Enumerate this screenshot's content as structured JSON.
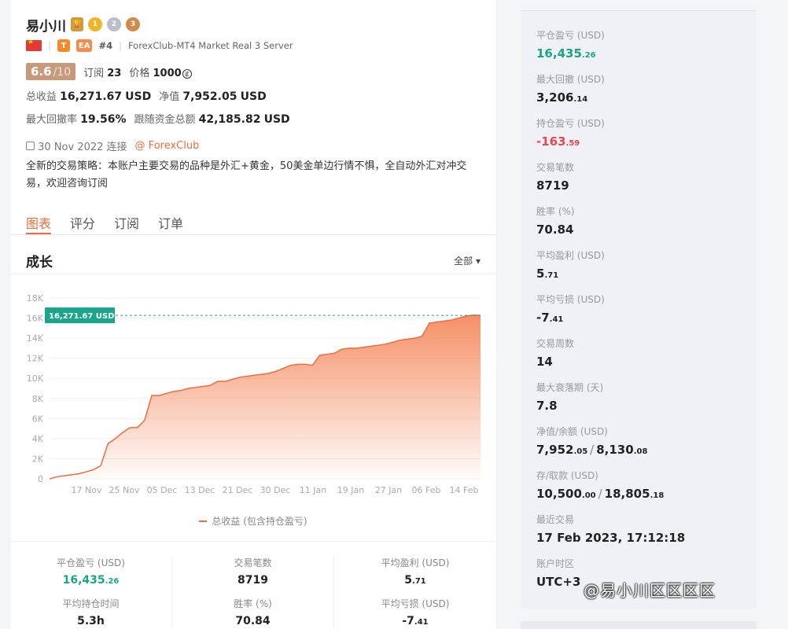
{
  "profile": {
    "name": "易小川",
    "medals": [
      "1",
      "2",
      "3"
    ],
    "tag_t": "T",
    "tag_ea": "EA",
    "rank": "#4",
    "server": "ForexClub-MT4 Market Real 3 Server",
    "score": "6.6",
    "score_den": "/10",
    "subs_label": "订阅",
    "subs_value": "23",
    "price_label": "价格",
    "price_value": "1000",
    "total_label": "总收益",
    "total_int": "16,271",
    "total_dec": ".67",
    "total_unit": "USD",
    "equity_label": "净值",
    "equity_int": "7,952",
    "equity_dec": ".05",
    "equity_unit": "USD",
    "dd_label": "最大回撤率",
    "dd_value": "19.56%",
    "follow_label": "跟随资金总额",
    "follow_int": "42,185",
    "follow_dec": ".82",
    "follow_unit": "USD",
    "connected": "30 Nov 2022 连接",
    "broker": "@ ForexClub",
    "description": "全新的交易策略：本账户主要交易的品种是外汇+黄金，50美金单边行情不惧，全自动外汇对冲交易，欢迎咨询订阅"
  },
  "tabs": [
    "图表",
    "评分",
    "订阅",
    "订单"
  ],
  "chart_section": {
    "title": "成长",
    "range": "全部 ▾"
  },
  "chart_data": {
    "type": "area",
    "x": [
      "10 Nov",
      "11 Nov",
      "12 Nov",
      "13 Nov",
      "14 Nov",
      "15 Nov",
      "16 Nov",
      "17 Nov",
      "18 Nov",
      "19 Nov",
      "20 Nov",
      "21 Nov",
      "22 Nov",
      "23 Nov",
      "24 Nov",
      "25 Nov",
      "27 Nov",
      "29 Nov",
      "1 Dec",
      "3 Dec",
      "5 Dec",
      "7 Dec",
      "9 Dec",
      "11 Dec",
      "13 Dec",
      "15 Dec",
      "17 Dec",
      "19 Dec",
      "21 Dec",
      "23 Dec",
      "25 Dec",
      "27 Dec",
      "29 Dec",
      "31 Dec",
      "2 Jan",
      "4 Jan",
      "6 Jan",
      "8 Jan",
      "10 Jan",
      "11 Jan",
      "12 Jan",
      "13 Jan",
      "15 Jan",
      "17 Jan",
      "19 Jan",
      "21 Jan",
      "23 Jan",
      "25 Jan",
      "27 Jan",
      "29 Jan",
      "31 Jan",
      "2 Feb",
      "4 Feb",
      "6 Feb",
      "8 Feb",
      "10 Feb",
      "12 Feb",
      "14 Feb",
      "16 Feb",
      "17 Feb"
    ],
    "y": [
      0,
      200,
      300,
      400,
      500,
      700,
      900,
      1300,
      3500,
      4000,
      4600,
      5100,
      5100,
      5800,
      8300,
      8300,
      8500,
      8700,
      8800,
      9000,
      9100,
      9200,
      9300,
      9700,
      9700,
      9900,
      10100,
      10200,
      10300,
      10400,
      10500,
      10700,
      11000,
      11300,
      11400,
      11400,
      11300,
      12300,
      12400,
      12500,
      12900,
      13000,
      13000,
      13100,
      13200,
      13300,
      13400,
      13600,
      13800,
      13900,
      14000,
      14200,
      15500,
      15600,
      15700,
      15800,
      16000,
      16200,
      16300,
      16271.67
    ],
    "x_ticks": [
      "17 Nov",
      "25 Nov",
      "05 Dec",
      "13 Dec",
      "21 Dec",
      "30 Dec",
      "11 Jan",
      "19 Jan",
      "27 Jan",
      "06 Feb",
      "14 Feb"
    ],
    "y_ticks": [
      "0",
      "2K",
      "4K",
      "6K",
      "8K",
      "10K",
      "12K",
      "14K",
      "16K",
      "18K"
    ],
    "ylim": [
      0,
      18000
    ],
    "last_label": "16,271.67 USD",
    "legend": "总收益 (包含持仓盈亏)",
    "colors": {
      "line": "#f06b3f",
      "fill": "#f58a5f",
      "tag": "#19a68a"
    }
  },
  "bottom_stats": [
    {
      "label": "平仓盈亏 (USD)",
      "int": "16,435",
      "dec": ".26",
      "green": true
    },
    {
      "label": "交易笔数",
      "int": "8719",
      "dec": "",
      "green": false
    },
    {
      "label": "平均盈利 (USD)",
      "int": "5",
      "dec": ".71",
      "green": false
    },
    {
      "label": "平均持仓时间",
      "int": "5.3h",
      "dec": "",
      "green": false
    },
    {
      "label": "胜率 (%)",
      "int": "70.84",
      "dec": "",
      "green": false
    },
    {
      "label": "平均亏损 (USD)",
      "int": "-7",
      "dec": ".41",
      "green": false
    }
  ],
  "right_stats": [
    {
      "label": "平仓盈亏 (USD)",
      "int": "16,435",
      "dec": ".26",
      "tone": "green"
    },
    {
      "label": "最大回撤 (USD)",
      "int": "3,206",
      "dec": ".14",
      "tone": ""
    },
    {
      "label": "持仓盈亏 (USD)",
      "int": "-163",
      "dec": ".59",
      "tone": "red"
    },
    {
      "label": "交易笔数",
      "int": "8719",
      "dec": "",
      "tone": ""
    },
    {
      "label": "胜率 (%)",
      "int": "70.84",
      "dec": "",
      "tone": ""
    },
    {
      "label": "平均盈利 (USD)",
      "int": "5",
      "dec": ".71",
      "tone": ""
    },
    {
      "label": "平均亏损 (USD)",
      "int": "-7",
      "dec": ".41",
      "tone": ""
    },
    {
      "label": "交易周数",
      "int": "14",
      "dec": "",
      "tone": ""
    },
    {
      "label": "最大衰落期 (天)",
      "int": "7.8",
      "dec": "",
      "tone": ""
    },
    {
      "label": "净值/余额 (USD)",
      "int": "7,952",
      "dec": ".05",
      "int2": "8,130",
      "dec2": ".08",
      "tone": ""
    },
    {
      "label": "存/取款 (USD)",
      "int": "10,500",
      "dec": ".00",
      "int2": "18,805",
      "dec2": ".18",
      "tone": ""
    },
    {
      "label": "最近交易",
      "int": "17 Feb 2023, 17:12:18",
      "dec": "",
      "tone": ""
    },
    {
      "label": "账户时区",
      "int": "UTC+3",
      "dec": "",
      "tone": ""
    }
  ],
  "watermark": "@易小川区区区区"
}
